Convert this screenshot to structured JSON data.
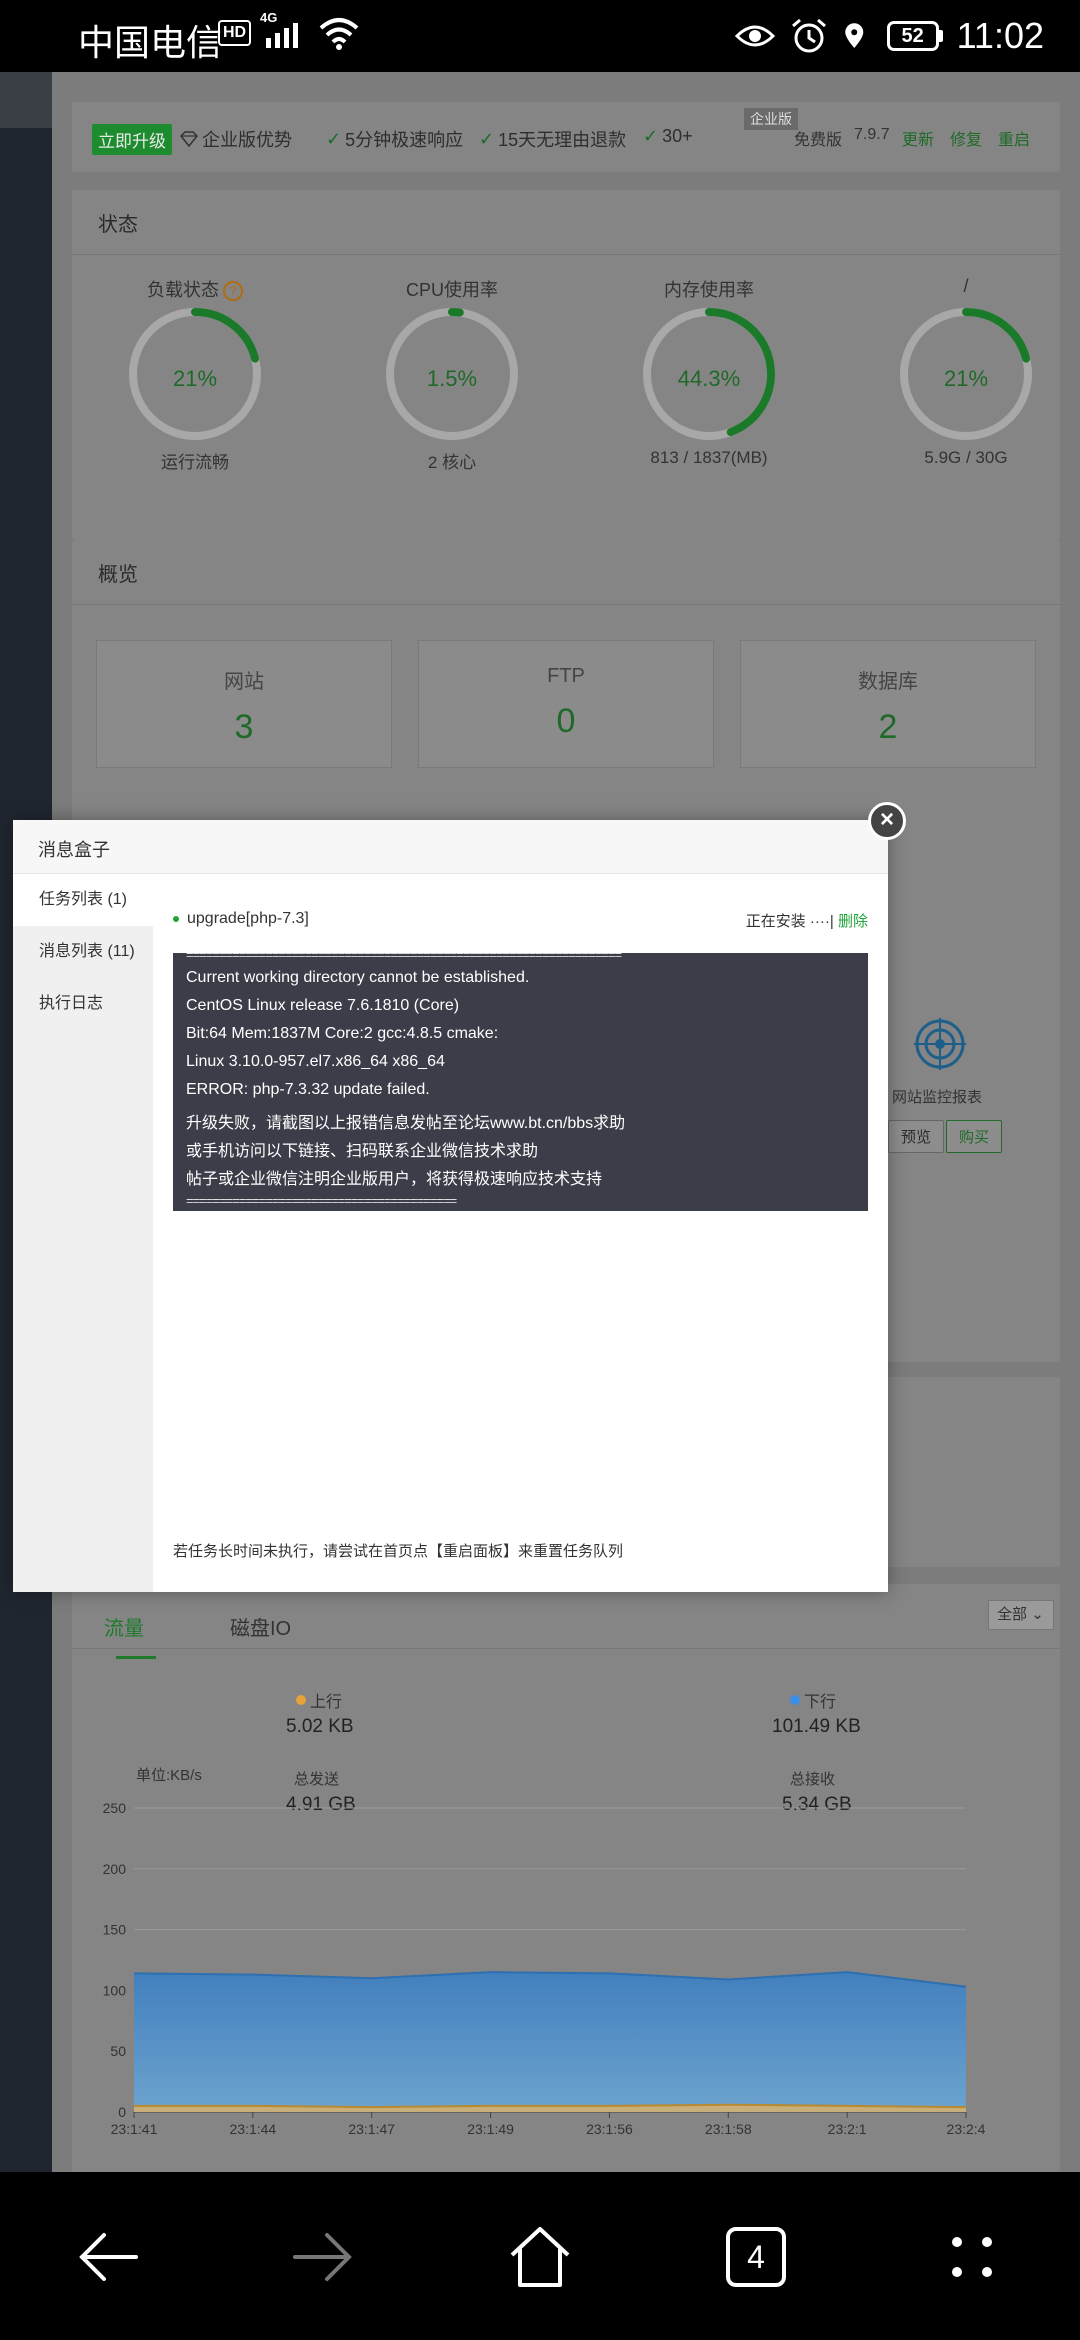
{
  "status_bar": {
    "carrier": "中国电信",
    "hd": "HD",
    "network": "4G",
    "battery": "52",
    "time": "11:02"
  },
  "topbar": {
    "upgrade": "立即升级",
    "enterprise_adv": "企业版优势",
    "feature1": "5分钟极速响应",
    "feature2": "15天无理由退款",
    "feature3": "30+",
    "ent_badge": "企业版",
    "edition": "免费版",
    "version": "7.9.7",
    "update": "更新",
    "repair": "修复",
    "restart": "重启"
  },
  "status": {
    "title": "状态",
    "gauges": [
      {
        "label": "负载状态",
        "value": "21%",
        "fraction": 0.21,
        "sub": "运行流畅"
      },
      {
        "label": "CPU使用率",
        "value": "1.5%",
        "fraction": 0.015,
        "sub": "2 核心"
      },
      {
        "label": "内存使用率",
        "value": "44.3%",
        "fraction": 0.443,
        "sub": "813 / 1837(MB)"
      },
      {
        "label": "/",
        "value": "21%",
        "fraction": 0.21,
        "sub": "5.9G / 30G"
      }
    ]
  },
  "overview": {
    "title": "概览",
    "items": [
      {
        "label": "网站",
        "value": "3"
      },
      {
        "label": "FTP",
        "value": "0"
      },
      {
        "label": "数据库",
        "value": "2"
      }
    ]
  },
  "software": {
    "monitor_label": "网站监控报表",
    "preview": "预览",
    "buy": "购买"
  },
  "traffic": {
    "tab_traffic": "流量",
    "tab_disk": "磁盘IO",
    "select": "全部",
    "up_label": "上行",
    "down_label": "下行",
    "up_value": "5.02 KB",
    "down_value": "101.49 KB",
    "sent_label": "总发送",
    "recv_label": "总接收",
    "sent_value": "4.91 GB",
    "recv_value": "5.34 GB",
    "colors": {
      "up": "#f0a830",
      "down": "#3a8ee6"
    }
  },
  "chart_data": {
    "type": "area",
    "ylabel": "单位:KB/s",
    "ylim": [
      0,
      250
    ],
    "yticks": [
      "0",
      "50",
      "100",
      "150",
      "200",
      "250"
    ],
    "x": [
      "23:1:41",
      "23:1:44",
      "23:1:47",
      "23:1:49",
      "23:1:56",
      "23:1:58",
      "23:2:1",
      "23:2:4"
    ],
    "series": [
      {
        "name": "上行",
        "values": [
          5,
          5,
          4,
          5,
          5,
          6,
          5,
          4
        ]
      },
      {
        "name": "下行",
        "values": [
          114,
          113,
          110,
          115,
          114,
          109,
          115,
          103
        ]
      }
    ]
  },
  "modal": {
    "title": "消息盒子",
    "close": "×",
    "side": [
      "任务列表 (1)",
      "消息列表 (11)",
      "执行日志"
    ],
    "task_name": "upgrade[php-7.3]",
    "task_status": "正在安装 ····|",
    "task_delete": "删除",
    "console": [
      "Current working directory cannot be established.",
      "CentOS Linux release 7.6.1810 (Core)",
      "Bit:64 Mem:1837M Core:2 gcc:4.8.5 cmake:",
      "Linux 3.10.0-957.el7.x86_64 x86_64",
      "ERROR: php-7.3.32 update failed.",
      "升级失败，请截图以上报错信息发帖至论坛www.bt.cn/bbs求助",
      "或手机访问以下链接、扫码联系企业微信技术求助",
      "帖子或企业微信注明企业版用户，将获得极速响应技术支持"
    ],
    "footer": "若任务长时间未执行，请尝试在首页点【重启面板】来重置任务队列"
  },
  "navbar": {
    "tabs_count": "4"
  }
}
